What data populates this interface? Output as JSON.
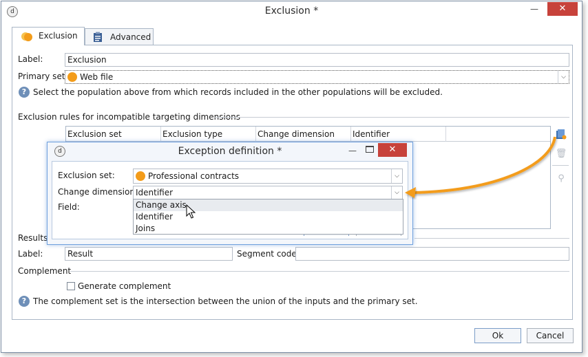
{
  "window": {
    "title": "Exclusion *",
    "app_icon_glyph": "d",
    "minimize_glyph": "—",
    "close_glyph": "✕"
  },
  "tabs": [
    {
      "label": "Exclusion",
      "icon": "exclusion-icon"
    },
    {
      "label": "Advanced",
      "icon": "clipboard-icon"
    }
  ],
  "general": {
    "label_caption": "Label:",
    "label_value": "Exclusion",
    "primary_set_caption": "Primary set:",
    "primary_set_value": "Web file",
    "help_text": "Select the population above from which records included in the other populations will be excluded."
  },
  "rules": {
    "section_title": "Exclusion rules for incompatible targeting dimensions",
    "columns": [
      "Exclusion set",
      "Exclusion type",
      "Change dimension",
      "Identifier"
    ]
  },
  "results": {
    "section_title": "Results",
    "label_caption": "Label:",
    "label_value": "Result",
    "segment_caption": "Segment code:",
    "segment_value": ""
  },
  "complement": {
    "section_title": "Complement",
    "checkbox_label": "Generate complement",
    "checked": false,
    "help_text": "The complement set is the intersection between the union of the inputs and the primary set."
  },
  "buttons": {
    "ok": "Ok",
    "cancel": "Cancel"
  },
  "dialog": {
    "title": "Exception definition *",
    "exclusion_set_caption": "Exclusion set:",
    "exclusion_set_value": "Professional contracts",
    "change_dimension_caption": "Change dimension:",
    "change_dimension_value": "Identifier",
    "field_caption": "Field:",
    "dropdown_options": [
      "Change axis",
      "Identifier",
      "Joins"
    ],
    "hovered_option": "Change axis"
  },
  "colors": {
    "accent_orange": "#f39c1a",
    "close_red": "#c7423b",
    "dialog_border": "#6fa0de"
  }
}
